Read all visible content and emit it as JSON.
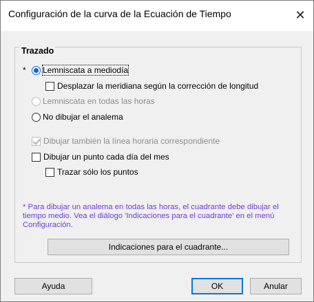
{
  "window": {
    "title": "Configuración de la curva de la Ecuación de Tiempo",
    "close_glyph": "✕"
  },
  "group": {
    "title": "Trazado",
    "marker": "*"
  },
  "options": {
    "lemniscata_mediodia": {
      "label": "Lemniscata a mediodía",
      "checked": true,
      "enabled": true
    },
    "desplazar_meridiana": {
      "label": "Desplazar la meridiana según la corrección de longitud",
      "checked": false,
      "enabled": true
    },
    "lemniscata_todas": {
      "label": "Lemniscata en todas las horas",
      "checked": false,
      "enabled": false
    },
    "no_dibujar": {
      "label": "No dibujar el analema",
      "checked": false,
      "enabled": true
    },
    "linea_horaria": {
      "label": "Dibujar también la línea horaria correspondiente",
      "checked": true,
      "enabled": false
    },
    "punto_cada_dia": {
      "label": "Dibujar un punto cada día del mes",
      "checked": false,
      "enabled": true
    },
    "solo_puntos": {
      "label": "Trazar sólo los puntos",
      "checked": false,
      "enabled": true
    }
  },
  "note": "* Para dibujar un analema en todas las horas, el cuadrante debe dibujar el tiempo medio. Vea el diálogo 'Indicaciones para el cuadrante' en el menú Configuración.",
  "buttons": {
    "indicaciones": "Indicaciones para el cuadrante...",
    "ayuda": "Ayuda",
    "ok": "OK",
    "anular": "Anular"
  },
  "colors": {
    "accent": "#0a64d6",
    "note": "#6a3dd6",
    "dialog_bg": "#f0f0f0"
  }
}
